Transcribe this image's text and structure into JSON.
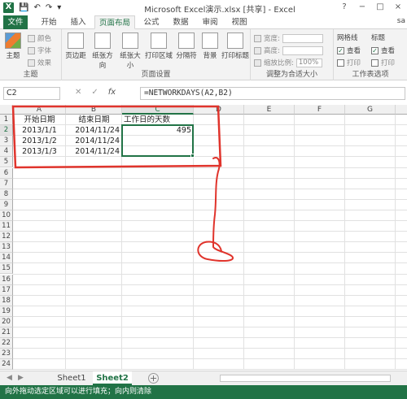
{
  "window": {
    "title": "Microsoft Excel演示.xlsx [共享] - Excel",
    "app_icon": "excel-logo",
    "controls": [
      "?",
      "−",
      "□",
      "×"
    ]
  },
  "qat": {
    "icons": [
      "save-icon",
      "undo-icon",
      "redo-icon",
      "customize-icon"
    ]
  },
  "tabs": {
    "file": "文件",
    "items": [
      "开始",
      "插入",
      "页面布局",
      "公式",
      "数据",
      "审阅",
      "视图"
    ],
    "active": "页面布局",
    "user": "sa"
  },
  "ribbon": {
    "themes": {
      "label": "主题",
      "button": "主题",
      "colors": "颜色",
      "fonts": "字体",
      "effects": "效果"
    },
    "page_setup": {
      "label": "页面设置",
      "buttons": [
        "页边距",
        "纸张方向",
        "纸张大小",
        "打印区域",
        "分隔符",
        "背景",
        "打印标题"
      ]
    },
    "scale": {
      "label": "调整为合适大小",
      "width": "宽度:",
      "height": "高度:",
      "ratio": "缩放比例:",
      "ratio_value": "100%"
    },
    "sheet_options": {
      "label": "工作表选项",
      "gridlines": "网格线",
      "headings": "标题",
      "view": "查看",
      "print": "打印"
    }
  },
  "formula_bar": {
    "name_box": "C2",
    "formula": "=NETWORKDAYS(A2,B2)",
    "icons": [
      "cancel-icon",
      "enter-icon",
      "fx-icon"
    ]
  },
  "grid": {
    "columns": [
      "A",
      "B",
      "C",
      "D",
      "E",
      "F",
      "G",
      "H"
    ],
    "rows": [
      "1",
      "2",
      "3",
      "4",
      "5",
      "6",
      "7",
      "8",
      "9",
      "10",
      "11",
      "12",
      "13",
      "14",
      "15",
      "16",
      "17",
      "18",
      "19",
      "20",
      "21",
      "22",
      "23",
      "24"
    ],
    "cells": {
      "A1": "开始日期",
      "B1": "结束日期",
      "C1": "工作日的天数",
      "A2": "2013/1/1",
      "B2": "2014/11/24",
      "C2": "495",
      "A3": "2013/1/2",
      "B3": "2014/11/24",
      "A4": "2013/1/3",
      "B4": "2014/11/24"
    },
    "selected": "C2",
    "annotation_color": "#e0342c"
  },
  "sheets": {
    "tabs": [
      "Sheet1",
      "Sheet2"
    ],
    "active": "Sheet2",
    "add": "+"
  },
  "status": {
    "text": "向外拖动选定区域可以进行填充；向内则清除"
  },
  "watermark": "Bai 经验"
}
